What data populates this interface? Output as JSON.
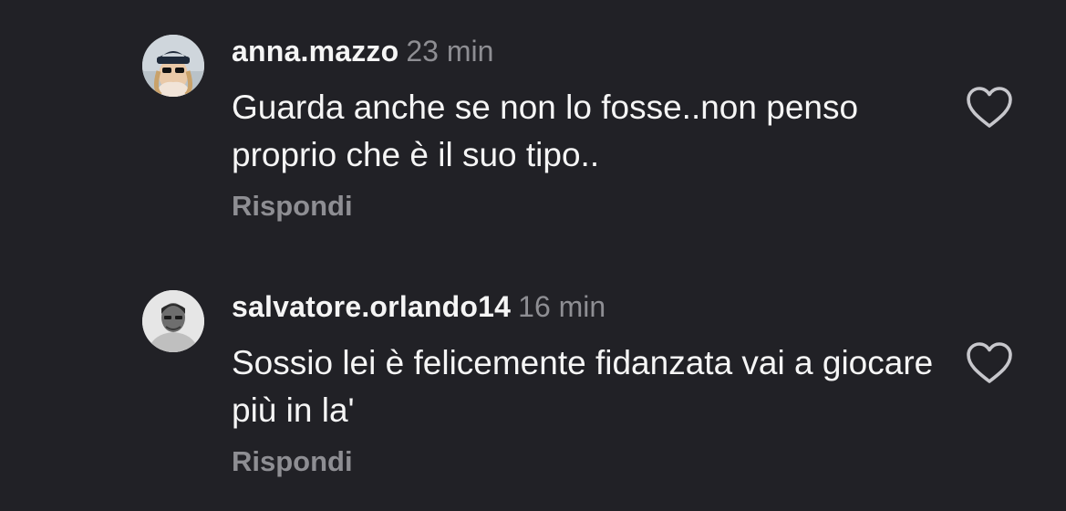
{
  "comments": [
    {
      "username": "anna.mazzo",
      "time": "23 min",
      "text": "Guarda anche se non lo fosse..non penso proprio che è il suo tipo..",
      "reply_label": "Rispondi",
      "avatar_icon": "user-avatar-photo",
      "like_icon": "heart-outline-icon"
    },
    {
      "username": "salvatore.orlando14",
      "time": "16 min",
      "text": "Sossio lei è felicemente fidanzata vai a giocare più in la'",
      "reply_label": "Rispondi",
      "avatar_icon": "user-avatar-photo",
      "like_icon": "heart-outline-icon"
    }
  ],
  "colors": {
    "background": "#212126",
    "primary_text": "#f5f5f5",
    "secondary_text": "#8e8e93"
  }
}
